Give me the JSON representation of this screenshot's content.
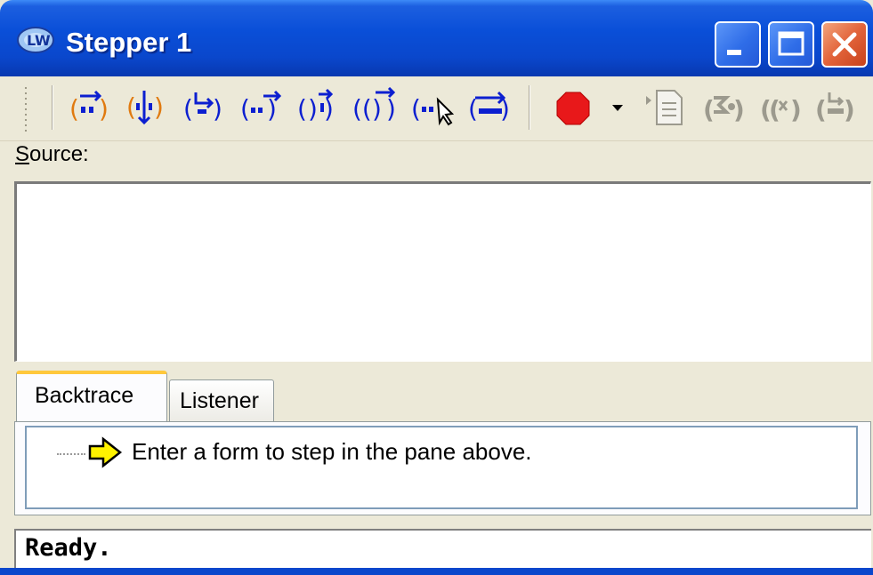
{
  "window": {
    "title": "Stepper 1",
    "app_icon": "lispworks-logo-icon"
  },
  "title_buttons": [
    {
      "name": "minimize",
      "icon": "minimize-icon"
    },
    {
      "name": "maximize",
      "icon": "maximize-icon"
    },
    {
      "name": "close",
      "icon": "close-icon"
    }
  ],
  "toolbar": {
    "tools": [
      {
        "name": "step",
        "icon": "step-icon"
      },
      {
        "name": "step-into",
        "icon": "step-into-icon"
      },
      {
        "name": "step-next",
        "icon": "step-next-icon"
      },
      {
        "name": "step-out",
        "icon": "step-out-icon"
      },
      {
        "name": "step-through-call",
        "icon": "step-through-icon"
      },
      {
        "name": "step-over",
        "icon": "step-over-icon"
      },
      {
        "name": "step-to-cursor",
        "icon": "step-to-cursor-icon"
      },
      {
        "name": "continue",
        "icon": "continue-icon"
      },
      {
        "name": "breakpoint",
        "icon": "breakpoint-icon"
      },
      {
        "name": "breakpoint-menu",
        "icon": "dropdown-arrow-icon"
      },
      {
        "name": "show-source",
        "icon": "show-source-icon"
      },
      {
        "name": "restart",
        "icon": "restart-icon"
      },
      {
        "name": "undo-macroexpand",
        "icon": "undo-macroexpand-icon"
      },
      {
        "name": "macroexpand",
        "icon": "macroexpand-icon"
      }
    ],
    "colors": {
      "step_blue": "#0c1fd0",
      "step_orange": "#e07a10",
      "breakpoint_red": "#e8181a",
      "disabled_grey": "#9c9a8e"
    }
  },
  "source": {
    "label_mnemonic": "S",
    "label_rest": "ource:",
    "value": ""
  },
  "tabs": [
    {
      "label": "Backtrace",
      "active": true
    },
    {
      "label": "Listener",
      "active": false
    }
  ],
  "backtrace": {
    "icon": "yellow-arrow-icon",
    "message": "Enter a form to step in the pane above."
  },
  "status": {
    "text": "Ready."
  }
}
